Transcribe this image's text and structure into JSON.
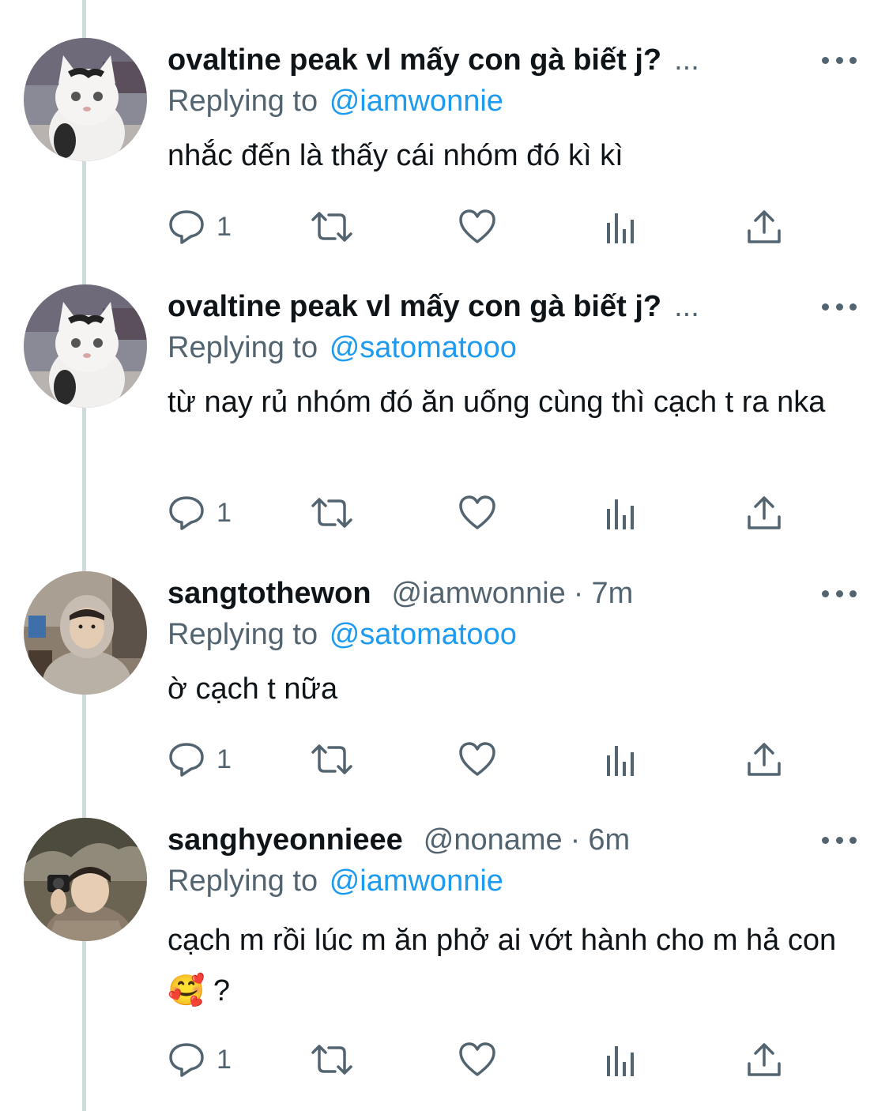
{
  "tweets": [
    {
      "name": "ovaltine peak vl mấy con gà biết j?",
      "truncation": "...",
      "handle": "",
      "time": "",
      "reply_prefix": "Replying to",
      "reply_to": "@iamwonnie",
      "text": "nhắc đến là thấy cái nhóm đó kì kì",
      "reply_count": "1",
      "avatar": "white-cat-avatar"
    },
    {
      "name": "ovaltine peak vl mấy con gà biết j?",
      "truncation": "...",
      "handle": "",
      "time": "",
      "reply_prefix": "Replying to",
      "reply_to": "@satomatooo",
      "text": "từ nay rủ nhóm đó ăn uống cùng thì cạch t ra nka",
      "reply_count": "1",
      "avatar": "white-cat-avatar"
    },
    {
      "name": "sangtothewon",
      "truncation": "",
      "handle": "@iamwonnie",
      "time": "7m",
      "reply_prefix": "Replying to",
      "reply_to": "@satomatooo",
      "text": "ờ cạch t nữa",
      "reply_count": "1",
      "avatar": "hooded-person-avatar"
    },
    {
      "name": "sanghyeonnieee",
      "truncation": "",
      "handle": "@noname",
      "time": "6m",
      "reply_prefix": "Replying to",
      "reply_to": "@iamwonnie",
      "text": "cạch m rồi lúc m ăn phở ai vớt hành cho m hả con🥰 ?",
      "reply_count": "1",
      "avatar": "camera-person-avatar"
    }
  ],
  "separator": "·",
  "icons": {
    "reply": "reply-icon",
    "retweet": "retweet-icon",
    "like": "heart-icon",
    "views": "views-icon",
    "share": "share-icon",
    "more": "more-icon"
  },
  "colors": {
    "link": "#1d9bf0",
    "secondary": "#536471",
    "text": "#0f1419",
    "thread_line": "#cfd9de"
  }
}
